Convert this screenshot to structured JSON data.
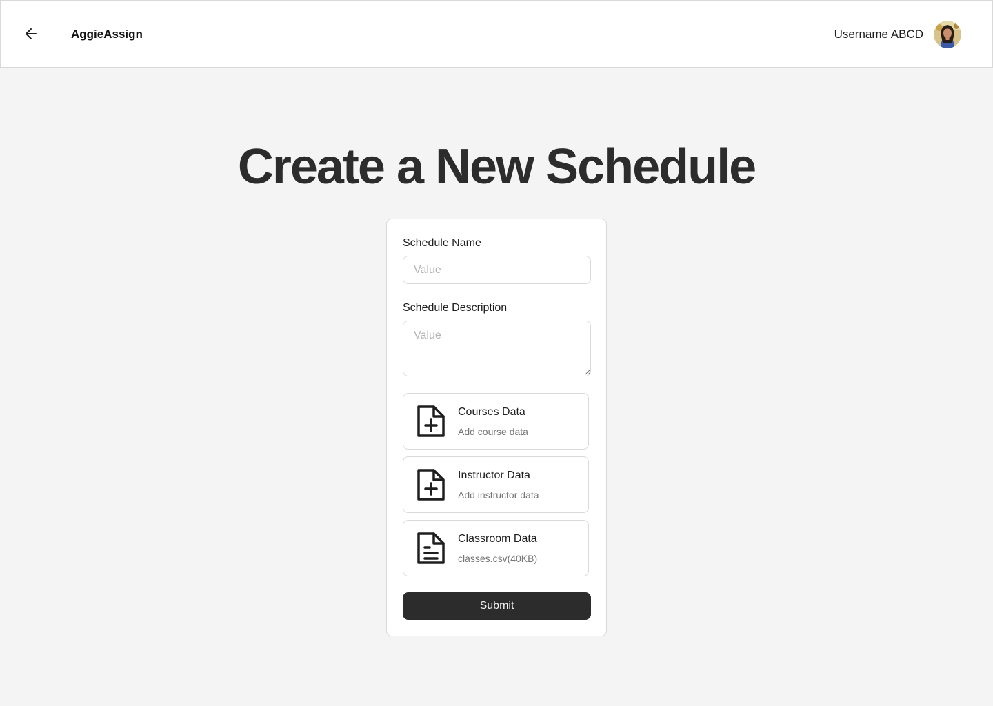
{
  "header": {
    "back_icon": "arrow-left-icon",
    "app_name": "AggieAssign",
    "username": "Username ABCD"
  },
  "main": {
    "title": "Create a New Schedule"
  },
  "form": {
    "schedule_name": {
      "label": "Schedule Name",
      "placeholder": "Value",
      "value": ""
    },
    "schedule_description": {
      "label": "Schedule Description",
      "placeholder": "Value",
      "value": ""
    },
    "uploads": [
      {
        "title": "Courses Data",
        "subtitle": "Add course data",
        "icon": "file-plus-icon"
      },
      {
        "title": "Instructor Data",
        "subtitle": "Add instructor data",
        "icon": "file-plus-icon"
      },
      {
        "title": "Classroom Data",
        "subtitle": "classes.csv(40KB)",
        "icon": "file-text-icon"
      }
    ],
    "submit_label": "Submit"
  },
  "colors": {
    "background": "#f4f4f4",
    "primary_button": "#2c2c2c",
    "border": "#d9d9d9"
  }
}
